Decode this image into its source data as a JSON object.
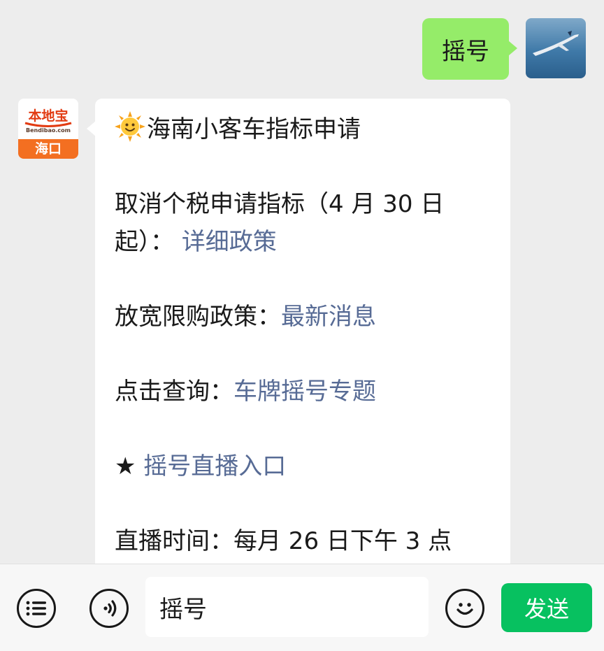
{
  "chat": {
    "outgoing": {
      "text": "摇号",
      "avatar_icon": "airplane-photo"
    },
    "incoming": {
      "avatar": {
        "brand": "本地宝",
        "url": "Bendibao.com",
        "city": "海口"
      },
      "title_icon": "sun-emoji",
      "title": "海南小客车指标申请",
      "items": [
        {
          "prefix": "取消个税申请指标（4 月 30 日",
          "prefix2": "起）：",
          "link": "详细政策"
        },
        {
          "prefix": "放宽限购政策：",
          "link": "最新消息"
        },
        {
          "prefix": "点击查询：",
          "link": "车牌摇号专题"
        },
        {
          "prefix": "★ ",
          "link": "摇号直播入口"
        },
        {
          "prefix": "直播时间：每月 26 日下午 3 点",
          "link": ""
        }
      ]
    }
  },
  "input_bar": {
    "menu_icon": "list-icon",
    "voice_icon": "voice-icon",
    "input_value": "摇号",
    "emoji_icon": "smiley-icon",
    "send_label": "发送"
  },
  "colors": {
    "background": "#ededed",
    "outgoing_bubble": "#95ec69",
    "link": "#576b95",
    "send_button": "#07c160"
  }
}
